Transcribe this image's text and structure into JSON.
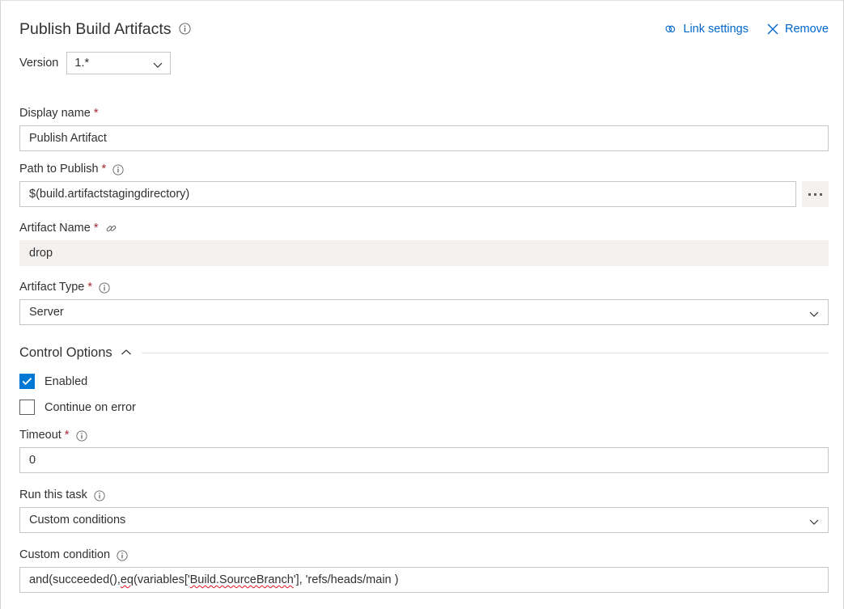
{
  "header": {
    "title": "Publish Build Artifacts",
    "title_info_icon": "info-icon",
    "actions": [
      {
        "label": "Link settings",
        "icon": "link-icon"
      },
      {
        "label": "Remove",
        "icon": "close-icon"
      }
    ]
  },
  "version": {
    "label": "Version",
    "value": "1.*",
    "chevron": "chevron-down-icon"
  },
  "fields": {
    "display_name": {
      "label": "Display name",
      "required": "*",
      "value": "Publish Artifact"
    },
    "path_to_publish": {
      "label": "Path to Publish",
      "required": "*",
      "info_icon": "info-icon",
      "value": "$(build.artifactstagingdirectory)",
      "browse_label": "..."
    },
    "artifact_name": {
      "label": "Artifact Name",
      "required": "*",
      "link_icon": "link-icon",
      "value": "drop"
    },
    "artifact_type": {
      "label": "Artifact Type",
      "required": "*",
      "info_icon": "info-icon",
      "value": "Server",
      "chevron": "chevron-down-icon"
    }
  },
  "control_options": {
    "title": "Control Options",
    "chevron": "chevron-up-icon",
    "enabled": {
      "label": "Enabled",
      "checked": true
    },
    "continue_on_error": {
      "label": "Continue on error",
      "checked": false
    },
    "timeout": {
      "label": "Timeout",
      "required": "*",
      "info_icon": "info-icon",
      "value": "0"
    },
    "run_this_task": {
      "label": "Run this task",
      "info_icon": "info-icon",
      "value": "Custom conditions",
      "chevron": "chevron-down-icon"
    },
    "custom_condition": {
      "label": "Custom condition",
      "info_icon": "info-icon",
      "value_part1": "and(succeeded(), ",
      "value_misspelled1": "eq",
      "value_part2": "(variables['",
      "value_misspelled2": "Build.SourceBranch",
      "value_part3": "'], 'refs/heads/main )"
    }
  },
  "colors": {
    "accent": "#0078d4",
    "link": "#0066cc",
    "required": "#a4262c",
    "spellcheck": "#e81123",
    "readonly_bg": "#f3f2f1",
    "border": "#c8c6c4"
  }
}
